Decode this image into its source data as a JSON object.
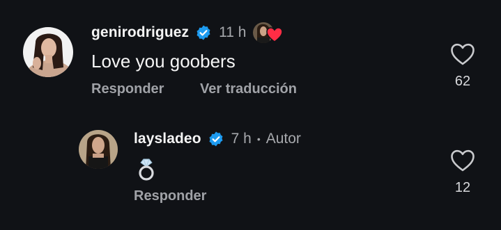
{
  "colors": {
    "background": "#101216",
    "text": "#f5f5f5",
    "muted": "#a7a9ad",
    "verified": "#1d9bf0",
    "heart": "#ff2d45"
  },
  "comments": [
    {
      "username": "genirodriguez",
      "verified_icon": "verified-badge-icon",
      "time": "11 h",
      "liked_by_creator": true,
      "liked_by_icon": "red-heart-icon",
      "text": "Love you goobers",
      "actions": {
        "reply": "Responder",
        "translate": "Ver traducción"
      },
      "like_icon": "heart-outline-icon",
      "likes": "62"
    },
    {
      "username": "laysladeo",
      "verified_icon": "verified-badge-icon",
      "time": "7 h",
      "separator": "•",
      "badge": "Autor",
      "text_icon": "ring-emoji-icon",
      "actions": {
        "reply": "Responder"
      },
      "like_icon": "heart-outline-icon",
      "likes": "12"
    }
  ]
}
